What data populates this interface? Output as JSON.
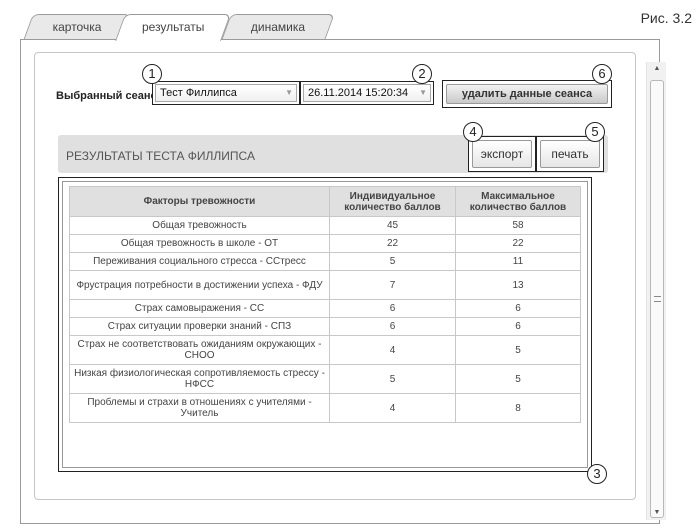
{
  "figure_label": "Рис. 3.2",
  "tabs": [
    "карточка",
    "результаты",
    "динамика"
  ],
  "session": {
    "label": "Выбранный сеанс",
    "test": "Тест Филлипса",
    "datetime": "26.11.2014 15:20:34",
    "delete_button": "удалить данные сеанса"
  },
  "results": {
    "title": "РЕЗУЛЬТАТЫ ТЕСТА ФИЛЛИПСА",
    "export_button": "экспорт",
    "print_button": "печать"
  },
  "table": {
    "headers": [
      "Факторы тревожности",
      "Индивидуальное количество баллов",
      "Максимальное количество баллов"
    ],
    "rows": [
      [
        "Общая тревожность",
        "45",
        "58"
      ],
      [
        "Общая тревожность в школе - ОТ",
        "22",
        "22"
      ],
      [
        "Переживания социального стресса - ССтресс",
        "5",
        "11"
      ],
      [
        "Фрустрация потребности в достижении успеха - ФДУ",
        "7",
        "13"
      ],
      [
        "Страх самовыражения - СС",
        "6",
        "6"
      ],
      [
        "Страх ситуации проверки знаний - СПЗ",
        "6",
        "6"
      ],
      [
        "Страх не соответствовать ожиданиям окружающих - СНОО",
        "4",
        "5"
      ],
      [
        "Низкая физиологическая сопротивляемость стрессу - НФСС",
        "5",
        "5"
      ],
      [
        "Проблемы и страхи в отношениях с учителями - Учитель",
        "4",
        "8"
      ]
    ]
  },
  "callouts": [
    "1",
    "2",
    "3",
    "4",
    "5",
    "6"
  ]
}
